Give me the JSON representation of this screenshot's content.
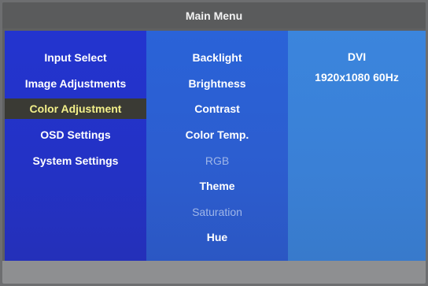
{
  "title": "Main Menu",
  "menu": {
    "items": [
      {
        "label": "Input Select"
      },
      {
        "label": "Image Adjustments"
      },
      {
        "label": "Color Adjustment",
        "selected": true
      },
      {
        "label": "OSD Settings"
      },
      {
        "label": "System Settings"
      }
    ]
  },
  "submenu": {
    "items": [
      {
        "label": "Backlight",
        "enabled": true
      },
      {
        "label": "Brightness",
        "enabled": true
      },
      {
        "label": "Contrast",
        "enabled": true
      },
      {
        "label": "Color Temp.",
        "enabled": true
      },
      {
        "label": "RGB",
        "enabled": false
      },
      {
        "label": "Theme",
        "enabled": true
      },
      {
        "label": "Saturation",
        "enabled": false
      },
      {
        "label": "Hue",
        "enabled": true
      }
    ]
  },
  "info": {
    "input": "DVI",
    "resolution": "1920x1080 60Hz"
  },
  "colors": {
    "selected_bg": "#3a3a34",
    "selected_text": "#f3f08a",
    "disabled_text": "#9fb6e8"
  }
}
